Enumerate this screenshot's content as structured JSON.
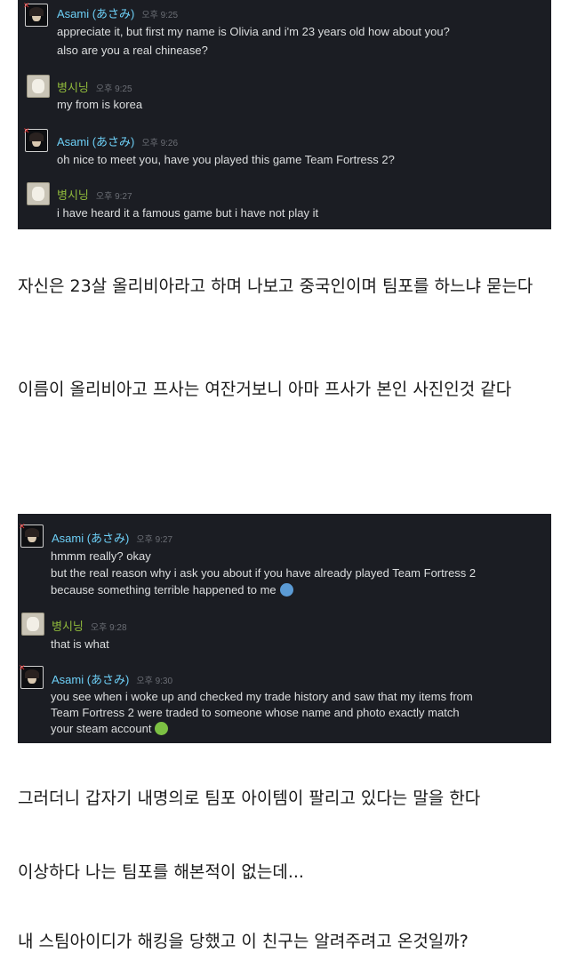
{
  "chat1": [
    {
      "sender": "Asami (あさみ)",
      "time": "오후 9:25",
      "lines": [
        "appreciate it, but first my name is Olivia and i'm 23 years old how about you?",
        "also are you a real chinease?"
      ]
    },
    {
      "sender": "병시닝",
      "time": "오후 9:25",
      "lines": [
        "my from is korea"
      ]
    },
    {
      "sender": "Asami (あさみ)",
      "time": "오후 9:26",
      "lines": [
        "oh nice to meet you, have you played this game Team Fortress 2?"
      ]
    },
    {
      "sender": "병시닝",
      "time": "오후 9:27",
      "lines": [
        "i have heard it a famous game but i have not play it"
      ]
    }
  ],
  "para1": "자신은 23살 올리비아라고 하며 나보고 중국인이며 팀포를 하느냐 묻는다",
  "para2": "이름이 올리비아고 프사는 여잔거보니 아마 프사가 본인 사진인것 같다",
  "chat2": [
    {
      "sender": "Asami (あさみ)",
      "time": "오후 9:27",
      "lines": [
        "hmmm really? okay",
        "but the real reason why i ask you about if you have already played Team Fortress 2",
        "because something terrible happened to me"
      ],
      "emote": "sad-emote"
    },
    {
      "sender": "병시닝",
      "time": "오후 9:28",
      "lines": [
        "that is what"
      ]
    },
    {
      "sender": "Asami (あさみ)",
      "time": "오후 9:30",
      "lines": [
        "you see when i woke up and checked my trade history and saw that my items from",
        "Team Fortress 2 were traded to someone whose name and photo exactly match",
        "your steam account"
      ],
      "emote": "angry-emote"
    }
  ],
  "para3": "그러더니 갑자기 내명의로 팀포 아이템이 팔리고 있다는 말을 한다",
  "para4": "이상하다 나는 팀포를 해본적이 없는데...",
  "para5": "내 스팀아이디가 해킹을 당했고 이 친구는 알려주려고 온것일까?"
}
